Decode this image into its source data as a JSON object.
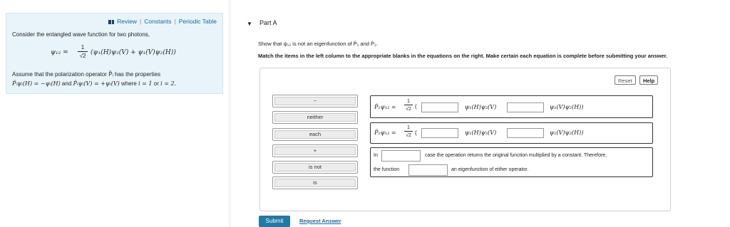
{
  "resources": {
    "review": "Review",
    "constants": "Constants",
    "periodic_table": "Periodic Table",
    "separator": "|"
  },
  "problem": {
    "intro": "Consider the entangled wave function for two photons,",
    "wavefunction_lhs": "ψ₁₂ =",
    "wavefunction_frac_num": "1",
    "wavefunction_frac_den": "√2",
    "wavefunction_rhs": "(ψ₁(H)ψ₂(V) + ψ₁(V)ψ₂(H))",
    "assume": "Assume that the polarization operator P̂ᵢ has the properties",
    "property_1": "P̂ᵢψᵢ(H) = −ψᵢ(H)",
    "property_and": "and",
    "property_2": "P̂ᵢψᵢ(V) = +ψᵢ(V)",
    "property_where": "where",
    "property_i1": "i = 1",
    "property_or": "or",
    "property_i2": "i = 2."
  },
  "part": {
    "title": "Part A",
    "prompt": "Show that ψ₁₂ is not an eigenfunction of P̂₁ and P̂₂.",
    "instruction": "Match the items in the left column to the appropriate blanks in the equations on the right. Make certain each equation is complete before submitting your answer."
  },
  "toolbar": {
    "reset": "Reset",
    "help": "Help"
  },
  "tiles": [
    "−",
    "neither",
    "each",
    "+",
    "is not",
    "is"
  ],
  "equations": {
    "eq1_lhs": "P̂₁ψ₁₂ =",
    "eq2_lhs": "P̂₂ψ₁₂ =",
    "frac_num": "1",
    "frac_den": "√2",
    "open_paren": "(",
    "term1": "ψ₁(H)ψ₂(V)",
    "term2": "ψ₁(V)ψ₂(H))",
    "stmt_in": "In",
    "stmt_rest": "case the operation returns the original function multiplied by a constant. Therefore,",
    "stmt_the_function": "the function",
    "stmt_end": "an eigenfunction of either operator."
  },
  "actions": {
    "submit": "Submit",
    "request_answer": "Request Answer"
  }
}
